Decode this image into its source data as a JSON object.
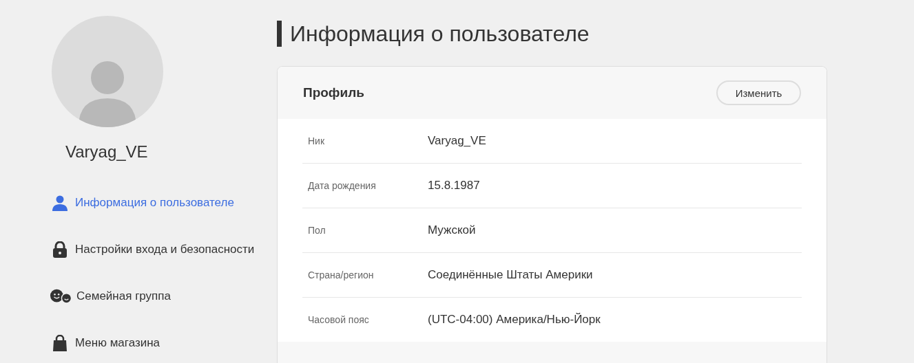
{
  "user": {
    "name": "Varyag_VE"
  },
  "nav": [
    {
      "kind": "person",
      "label": "Информация о пользователе",
      "selected": true
    },
    {
      "kind": "lock",
      "label": "Настройки входа и безопасности",
      "selected": false
    },
    {
      "kind": "family",
      "label": "Семейная группа",
      "selected": false
    },
    {
      "kind": "bag",
      "label": "Меню магазина",
      "selected": false
    }
  ],
  "page_title": "Информация о пользователе",
  "profile": {
    "title": "Профиль",
    "edit_button": "Изменить",
    "rows": [
      {
        "label": "Ник",
        "value": "Varyag_VE"
      },
      {
        "label": "Дата рождения",
        "value": "15.8.1987"
      },
      {
        "label": "Пол",
        "value": "Мужской"
      },
      {
        "label": "Страна/регион",
        "value": "Соединённые Штаты Америки"
      },
      {
        "label": "Часовой пояс",
        "value": "(UTC-04:00) Америка/Нью-Йорк"
      }
    ]
  }
}
